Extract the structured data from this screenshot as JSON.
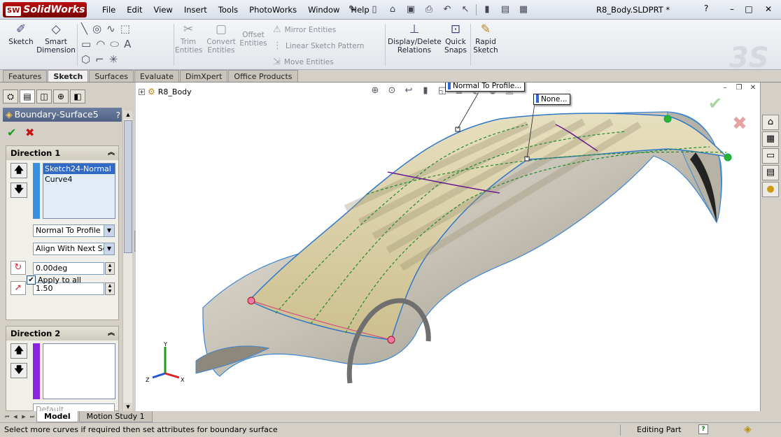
{
  "app": {
    "name": "SolidWorks",
    "badge": "SW"
  },
  "menu": [
    "File",
    "Edit",
    "View",
    "Insert",
    "Tools",
    "PhotoWorks",
    "Window",
    "Help"
  ],
  "document": {
    "title": "R8_Body.SLDPRT *"
  },
  "window_controls": {
    "help": "?",
    "minimize": "–",
    "maximize": "□",
    "close": "✕"
  },
  "toolbar": {
    "sketch": "Sketch",
    "smart_dimension": [
      "Smart",
      "Dimension"
    ],
    "trim_entities": [
      "Trim",
      "Entities"
    ],
    "convert_entities": [
      "Convert",
      "Entities"
    ],
    "offset_entities": [
      "Offset",
      "Entities"
    ],
    "mirror_entities": "Mirror Entities",
    "linear_sketch_pattern": "Linear Sketch Pattern",
    "move_entities": "Move Entities",
    "display_delete_relations": [
      "Display/Delete",
      "Relations"
    ],
    "quick_snaps": [
      "Quick",
      "Snaps"
    ],
    "rapid_sketch": [
      "Rapid",
      "Sketch"
    ]
  },
  "tabs": [
    "Features",
    "Sketch",
    "Surfaces",
    "Evaluate",
    "DimXpert",
    "Office Products"
  ],
  "active_tab": "Sketch",
  "property_manager": {
    "title": "Boundary-Surface5",
    "help": "?",
    "direction1": {
      "label": "Direction 1",
      "curves": [
        "Sketch24-Normal",
        "Curve4"
      ],
      "tangency": "Normal To Profile",
      "alignment": "Align With Next Sec",
      "draft_angle": "0.00deg",
      "tangent_length": "1.50",
      "apply_to_all": "Apply to all"
    },
    "direction2": {
      "label": "Direction 2",
      "option": "Default"
    }
  },
  "bottom_tabs": [
    "Model",
    "Motion Study 1"
  ],
  "status": {
    "message": "Select more curves if required then set attributes for boundary surface",
    "mode": "Editing Part"
  },
  "viewport": {
    "tree_root": "R8_Body",
    "callout_1": "Normal To Profile...",
    "callout_2": "None..."
  },
  "colors": {
    "direction1_bar": "#3a8fe0",
    "direction2_bar": "#8a22e0",
    "accent": "#3169c6"
  }
}
